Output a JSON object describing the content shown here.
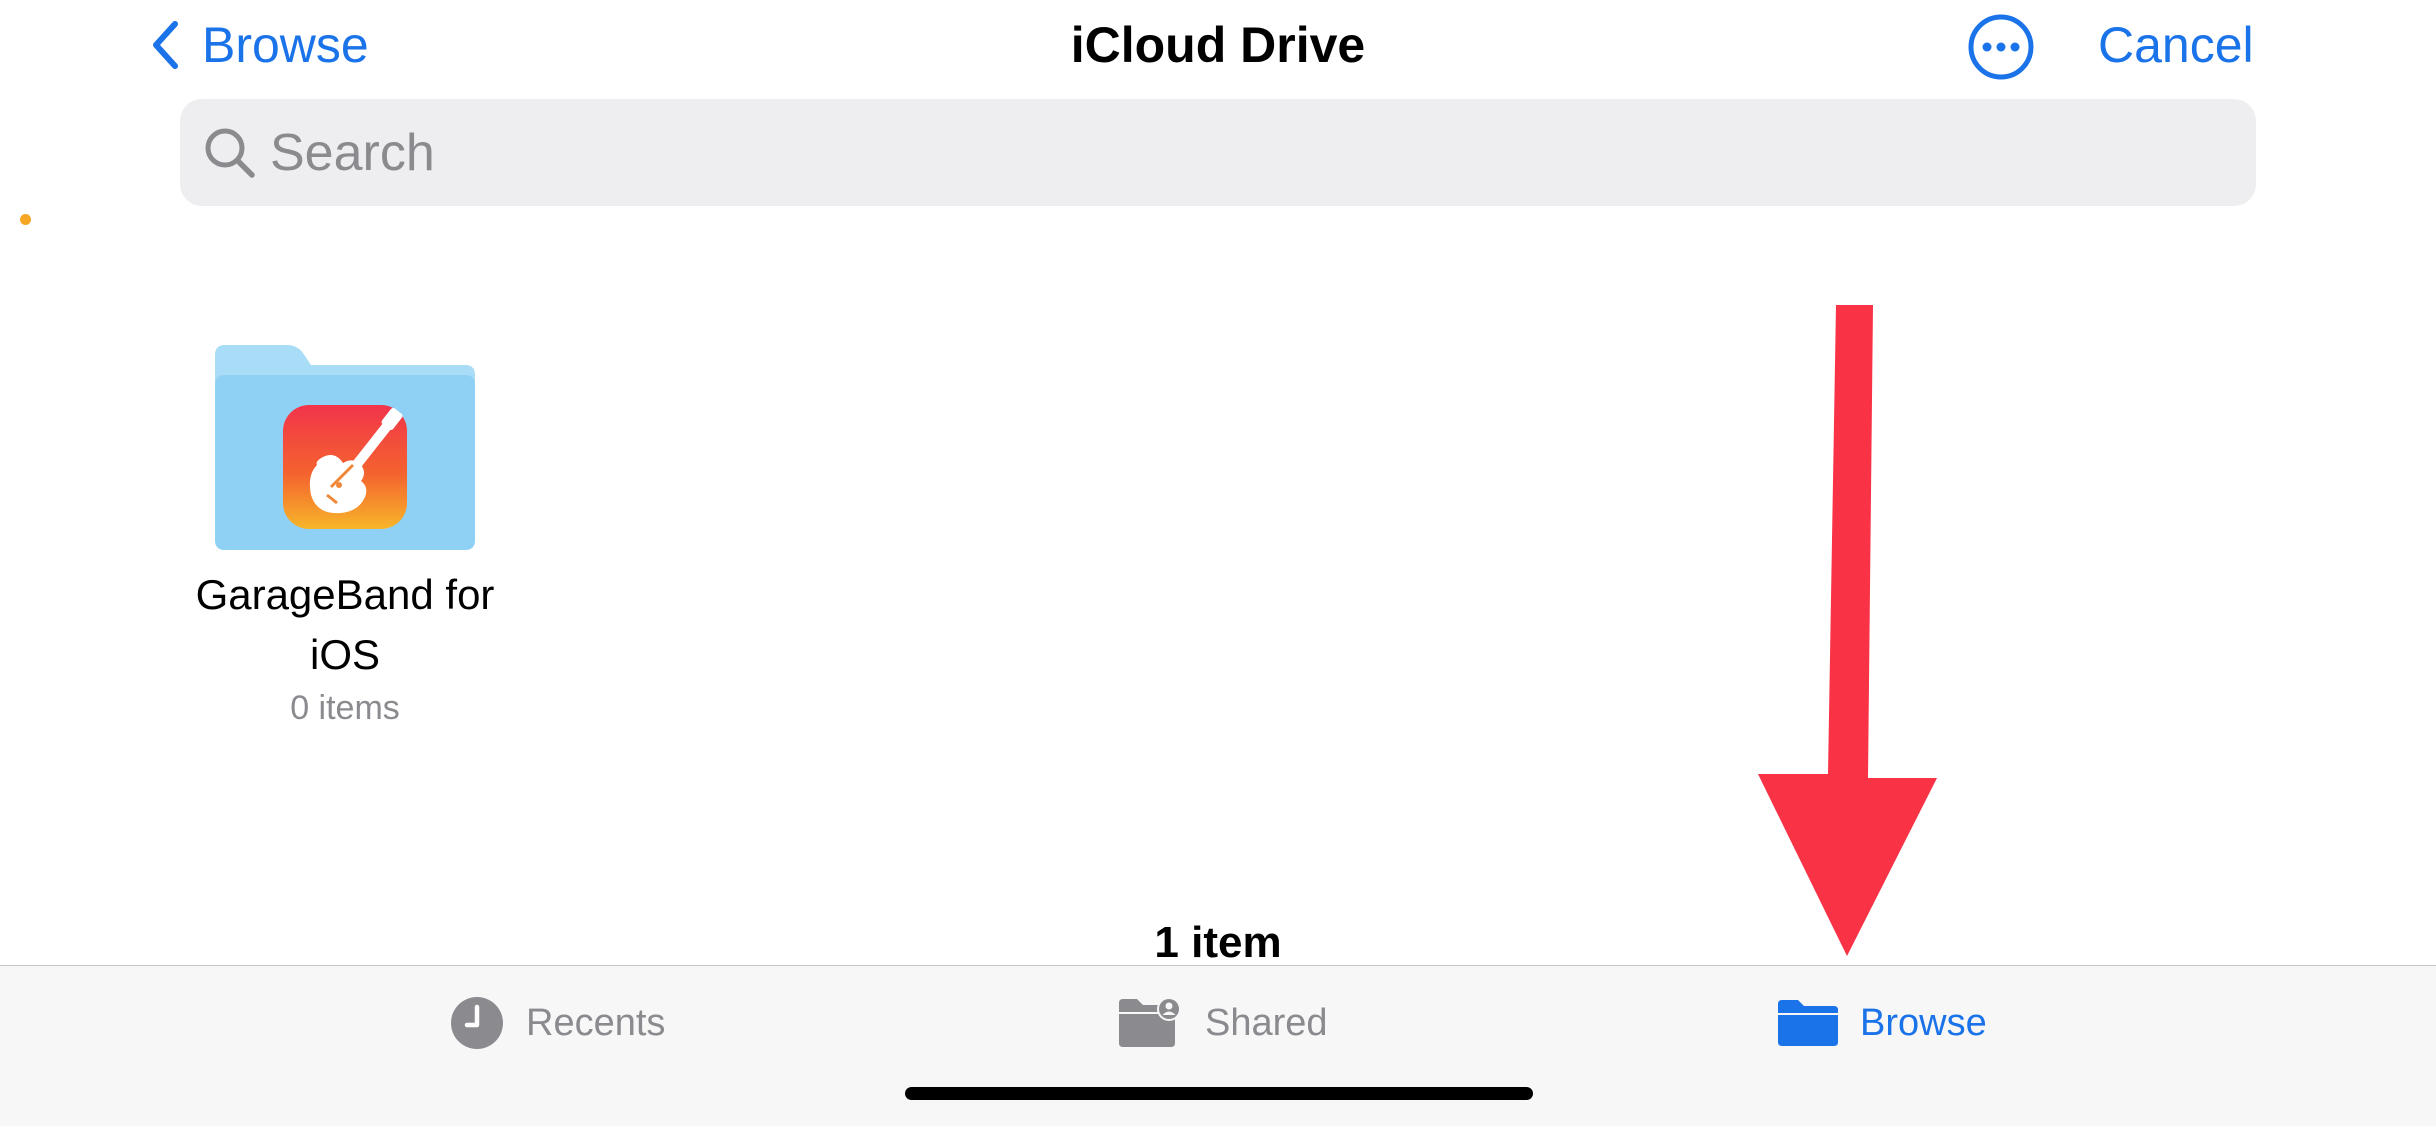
{
  "nav": {
    "back_label": "Browse",
    "title": "iCloud Drive",
    "more_icon": "ellipsis-circle-icon",
    "cancel_label": "Cancel"
  },
  "search": {
    "placeholder": "Search",
    "value": ""
  },
  "items": [
    {
      "name": "GarageBand for iOS",
      "name_line1": "GarageBand for",
      "name_line2": "iOS",
      "count": "0 items",
      "icon": "garageband-folder-icon"
    }
  ],
  "footer": {
    "item_count": "1 item"
  },
  "tabs": [
    {
      "label": "Recents",
      "icon": "clock-icon",
      "active": false
    },
    {
      "label": "Shared",
      "icon": "shared-folder-icon",
      "active": false
    },
    {
      "label": "Browse",
      "icon": "folder-icon",
      "active": true
    }
  ],
  "colors": {
    "accent": "#1a73e8",
    "annotation_arrow": "#f93246",
    "inactive": "#8a8a8f"
  }
}
